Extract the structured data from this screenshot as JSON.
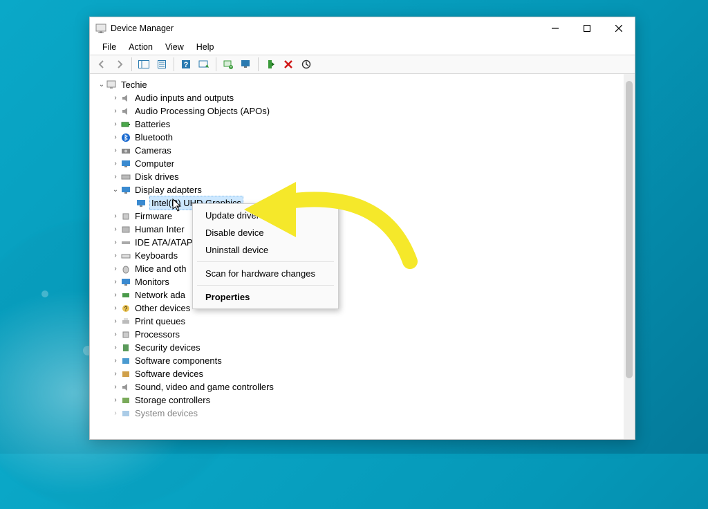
{
  "titlebar": {
    "title": "Device Manager"
  },
  "menubar": {
    "file": "File",
    "action": "Action",
    "view": "View",
    "help": "Help"
  },
  "tree": {
    "root": "Techie",
    "items": [
      {
        "label": "Audio inputs and outputs"
      },
      {
        "label": "Audio Processing Objects (APOs)"
      },
      {
        "label": "Batteries"
      },
      {
        "label": "Bluetooth"
      },
      {
        "label": "Cameras"
      },
      {
        "label": "Computer"
      },
      {
        "label": "Disk drives"
      },
      {
        "label": "Display adapters",
        "expanded": true,
        "child": "Intel(R) UHD Graphics"
      },
      {
        "label": "Firmware"
      },
      {
        "label": "Human Inter"
      },
      {
        "label": "IDE ATA/ATAP"
      },
      {
        "label": "Keyboards"
      },
      {
        "label": "Mice and oth"
      },
      {
        "label": "Monitors"
      },
      {
        "label": "Network ada"
      },
      {
        "label": "Other devices"
      },
      {
        "label": "Print queues"
      },
      {
        "label": "Processors"
      },
      {
        "label": "Security devices"
      },
      {
        "label": "Software components"
      },
      {
        "label": "Software devices"
      },
      {
        "label": "Sound, video and game controllers"
      },
      {
        "label": "Storage controllers"
      },
      {
        "label": "System devices"
      }
    ]
  },
  "context_menu": {
    "update_driver": "Update driver",
    "disable_device": "Disable device",
    "uninstall_device": "Uninstall device",
    "scan_hardware": "Scan for hardware changes",
    "properties": "Properties"
  }
}
